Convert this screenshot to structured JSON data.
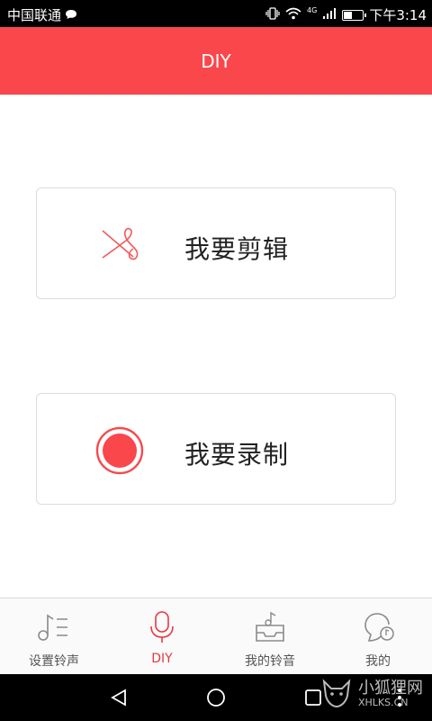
{
  "status_bar": {
    "carrier": "中国联通",
    "network": "4G",
    "time": "下午3:14",
    "battery_level": 0.4
  },
  "header": {
    "title": "DIY"
  },
  "actions": {
    "cut_label": "我要剪辑",
    "record_label": "我要录制"
  },
  "tabs": [
    {
      "label": "设置铃声",
      "icon": "music-note-list-icon",
      "active": false
    },
    {
      "label": "DIY",
      "icon": "microphone-icon",
      "active": true
    },
    {
      "label": "我的铃音",
      "icon": "music-tray-icon",
      "active": false
    },
    {
      "label": "我的",
      "icon": "profile-music-icon",
      "active": false
    }
  ],
  "watermark": {
    "logo_text": "小狐狸网",
    "url": "XHLKS.CN"
  },
  "colors": {
    "accent": "#f9474b",
    "active_tab": "#e8383d",
    "inactive_tab": "#555555"
  }
}
